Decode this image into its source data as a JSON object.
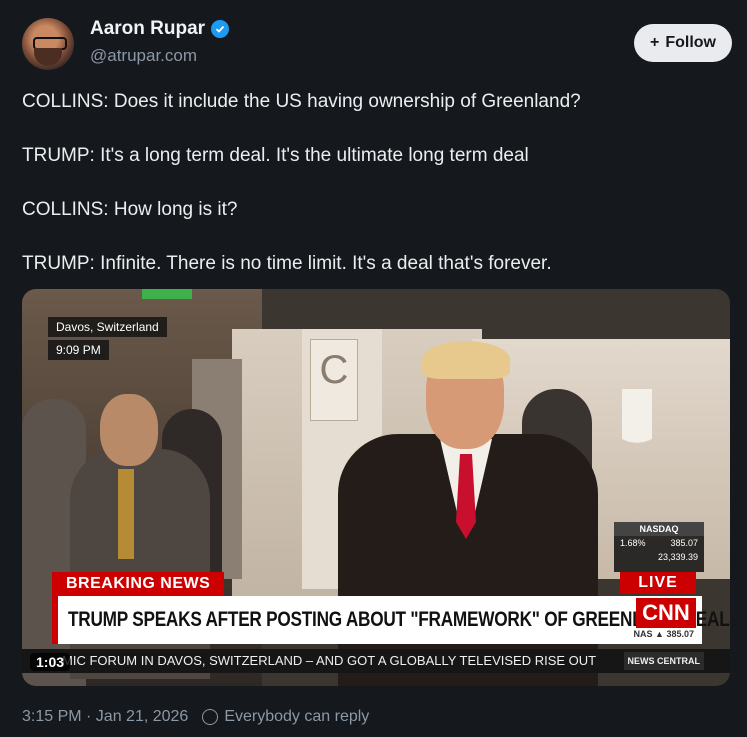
{
  "author": {
    "name": "Aaron Rupar",
    "handle": "@atrupar.com",
    "verified_icon": "verified-badge-icon"
  },
  "follow_button": {
    "icon": "+",
    "label": "Follow"
  },
  "post": {
    "lines": [
      "COLLINS: Does it include the US having ownership of Greenland?",
      "TRUMP: It's a long term deal. It's the ultimate long term deal",
      "COLLINS: How long is it?",
      "TRUMP: Infinite. There is no time limit. It's a deal that's forever."
    ]
  },
  "video": {
    "location": "Davos, Switzerland",
    "local_time": "9:09 PM",
    "breaking_label": "BREAKING NEWS",
    "live_label": "LIVE",
    "headline": "TRUMP SPEAKS AFTER POSTING ABOUT \"FRAMEWORK\" OF GREENLAND DEAL",
    "network": "CNN",
    "ticker": "MIC FORUM IN DAVOS, SWITZERLAND – AND GOT A GLOBALLY TELEVISED RISE OUT",
    "news_central": "NEWS CENTRAL",
    "duration": "1:03",
    "nasdaq": {
      "label": "NASDAQ",
      "pct": "1.68%",
      "change": "385.07",
      "value": "23,339.39",
      "bottom": "NAS ▲ 385.07"
    }
  },
  "footer": {
    "timestamp": "3:15 PM · Jan 21, 2026",
    "reply_setting": "Everybody can reply"
  },
  "colors": {
    "background": "#15181d",
    "accent": "#1d9bf0",
    "cnn_red": "#cc0000"
  }
}
